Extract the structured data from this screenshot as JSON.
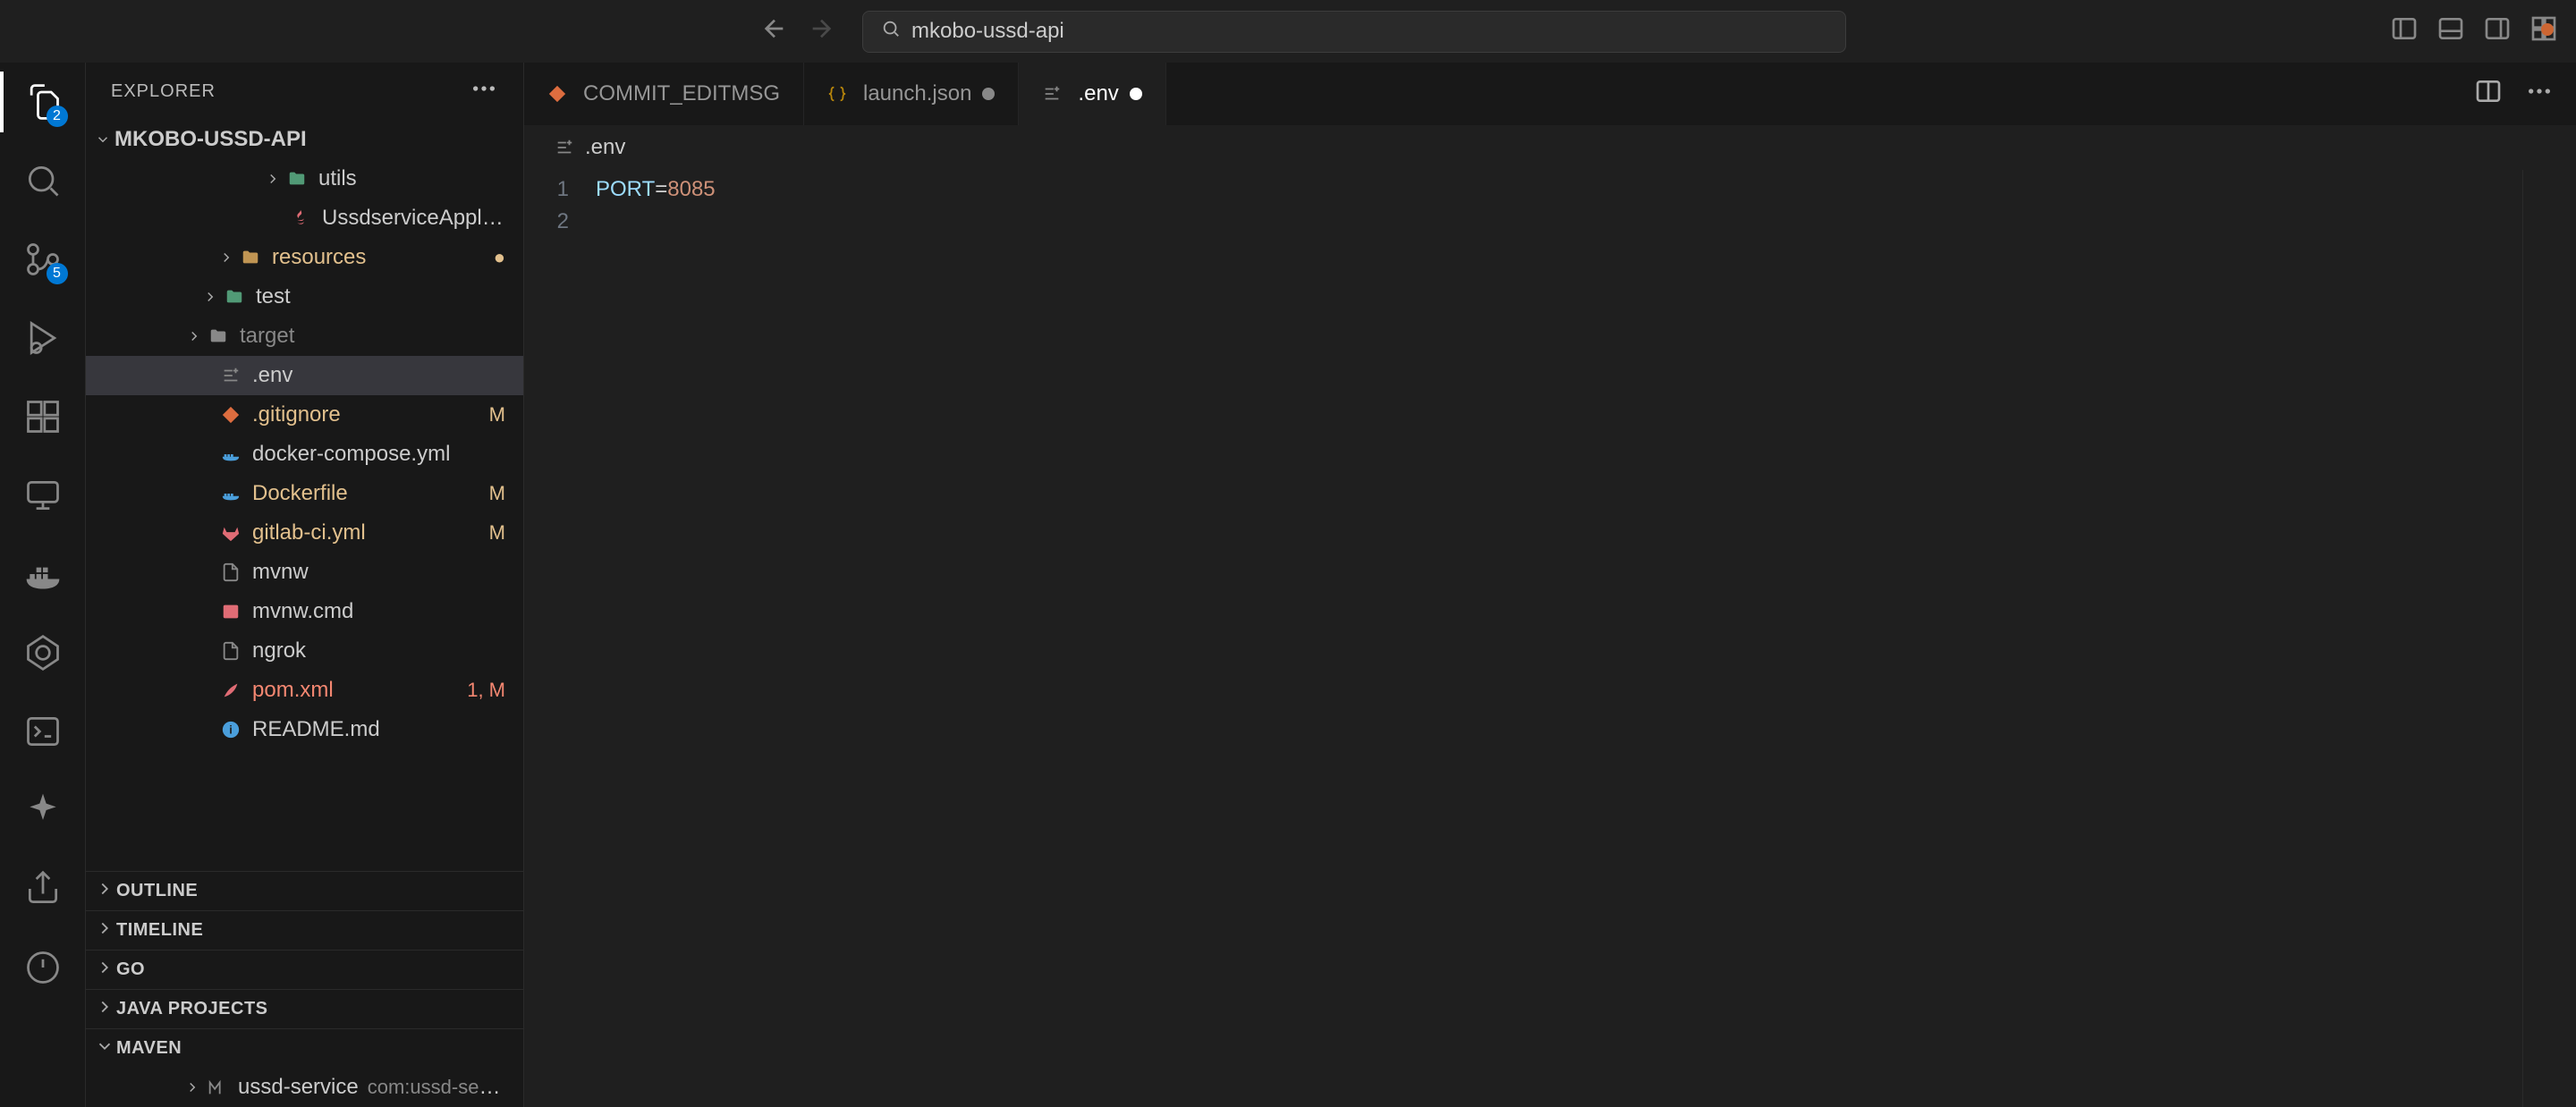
{
  "titlebar": {
    "search_text": "mkobo-ussd-api"
  },
  "activity": {
    "explorer_badge": "2",
    "scm_badge": "5"
  },
  "sidebar": {
    "header": "EXPLORER",
    "root": "MKOBO-USSD-API",
    "files": {
      "utils": "utils",
      "ussd_app": "UssdserviceApplicatio...",
      "resources": "resources",
      "test": "test",
      "target": "target",
      "env": ".env",
      "gitignore": ".gitignore",
      "gitignore_dec": "M",
      "docker_compose": "docker-compose.yml",
      "dockerfile": "Dockerfile",
      "dockerfile_dec": "M",
      "gitlab_ci": "gitlab-ci.yml",
      "gitlab_ci_dec": "M",
      "mvnw": "mvnw",
      "mvnw_cmd": "mvnw.cmd",
      "ngrok": "ngrok",
      "pom": "pom.xml",
      "pom_dec": "1, M",
      "readme": "README.md"
    },
    "sections": {
      "outline": "OUTLINE",
      "timeline": "TIMELINE",
      "go": "GO",
      "java_projects": "JAVA PROJECTS",
      "maven": "MAVEN"
    },
    "maven_item": {
      "name": "ussd-service",
      "detail": "com:ussd-serv..."
    }
  },
  "tabs": {
    "commit": "COMMIT_EDITMSG",
    "launch": "launch.json",
    "env": ".env"
  },
  "breadcrumb": {
    "env": ".env"
  },
  "editor": {
    "line1_key": "PORT",
    "line1_op": "=",
    "line1_val": "8085",
    "ln1": "1",
    "ln2": "2"
  }
}
